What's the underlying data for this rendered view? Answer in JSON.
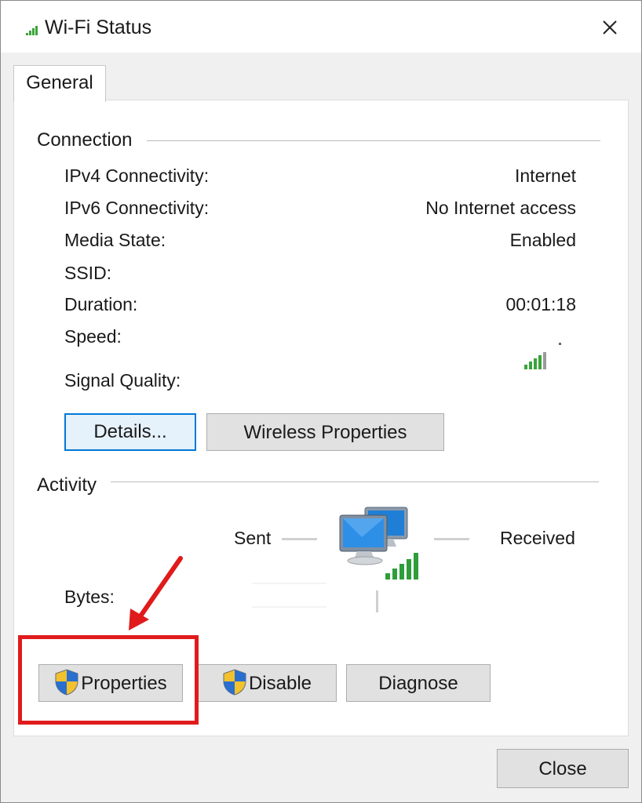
{
  "window": {
    "title": "Wi-Fi Status",
    "close_icon": "close-icon",
    "title_icon": "wifi-signal-icon"
  },
  "tabs": [
    {
      "label": "General"
    }
  ],
  "connection": {
    "section_title": "Connection",
    "rows": [
      {
        "label": "IPv4 Connectivity:",
        "value": "Internet"
      },
      {
        "label": "IPv6 Connectivity:",
        "value": "No Internet access"
      },
      {
        "label": "Media State:",
        "value": "Enabled"
      },
      {
        "label": "SSID:",
        "value": ""
      },
      {
        "label": "Duration:",
        "value": "00:01:18"
      },
      {
        "label": "Speed:",
        "value": ""
      },
      {
        "label": "Signal Quality:",
        "value": "",
        "icon": "signal-bars-icon"
      }
    ],
    "details_button": "Details...",
    "wireless_properties_button": "Wireless Properties"
  },
  "activity": {
    "section_title": "Activity",
    "sent_label": "Sent",
    "received_label": "Received",
    "bytes_label": "Bytes:",
    "icon": "network-computers-icon"
  },
  "actions": {
    "properties_button": "Properties",
    "disable_button": "Disable",
    "diagnose_button": "Diagnose",
    "shield_icon": "uac-shield-icon"
  },
  "footer": {
    "close_button": "Close"
  },
  "annotation": {
    "highlight_color": "#e01b1b",
    "target": "properties-button"
  },
  "colors": {
    "focus_border": "#0078d7",
    "button_face": "#e1e1e1",
    "signal_green": "#3aa43a"
  }
}
